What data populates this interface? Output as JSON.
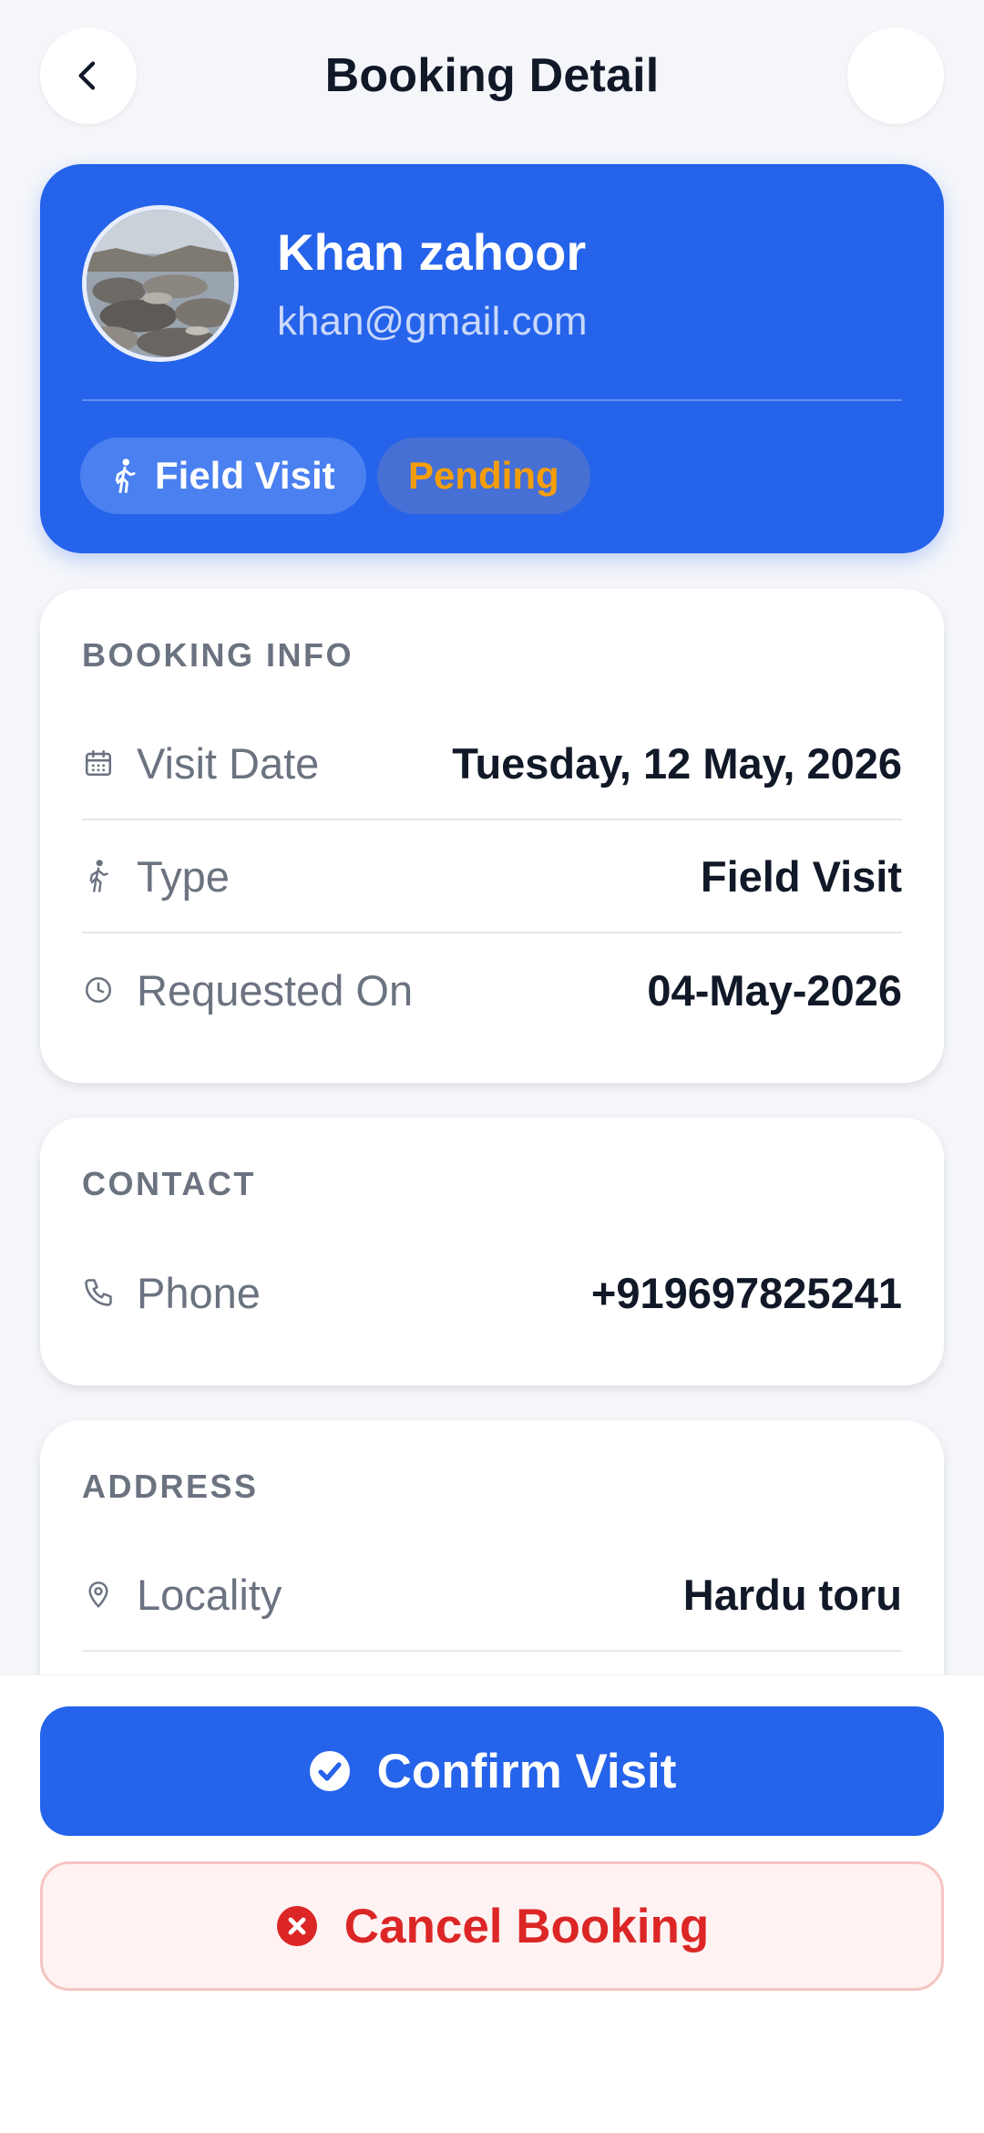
{
  "header": {
    "title": "Booking Detail",
    "back_icon": "chevron-left-icon"
  },
  "profile": {
    "name": "Khan zahoor",
    "email": "khan@gmail.com",
    "type_chip": "Field Visit",
    "status_chip": "Pending",
    "status_color": "#F59E0B",
    "accent_color": "#2563EB"
  },
  "booking_info": {
    "title": "BOOKING INFO",
    "rows": [
      {
        "icon": "calendar-icon",
        "label": "Visit Date",
        "value": "Tuesday, 12 May, 2026"
      },
      {
        "icon": "walking-person-icon",
        "label": "Type",
        "value": "Field Visit"
      },
      {
        "icon": "clock-icon",
        "label": "Requested On",
        "value": "04-May-2026"
      }
    ]
  },
  "contact": {
    "title": "CONTACT",
    "rows": [
      {
        "icon": "phone-icon",
        "label": "Phone",
        "value": "+919697825241"
      }
    ]
  },
  "address": {
    "title": "ADDRESS",
    "rows": [
      {
        "icon": "location-pin-icon",
        "label": "Locality",
        "value": "Hardu toru"
      }
    ]
  },
  "actions": {
    "confirm_label": "Confirm Visit",
    "cancel_label": "Cancel Booking",
    "cancel_color": "#DC2626"
  }
}
